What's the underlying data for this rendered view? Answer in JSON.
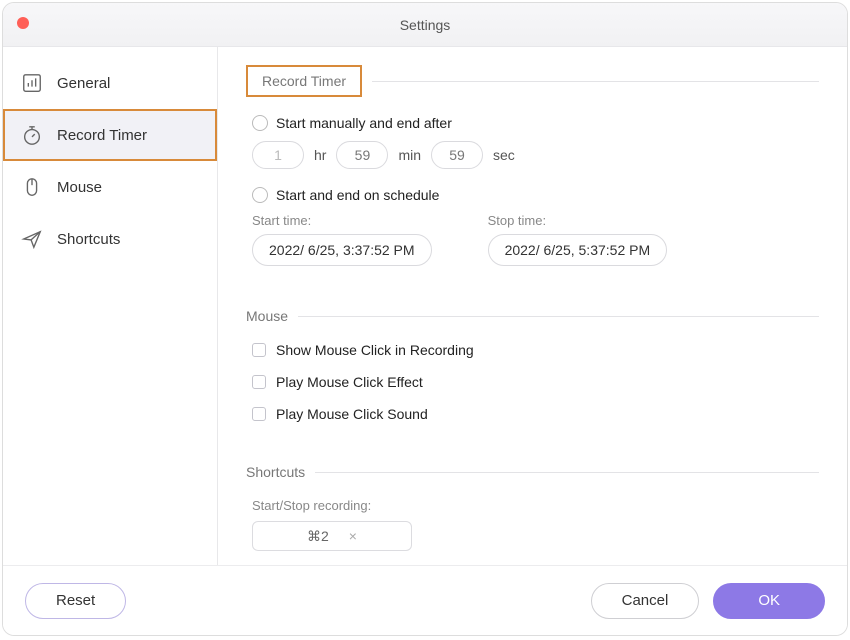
{
  "window": {
    "title": "Settings"
  },
  "sidebar": {
    "items": [
      {
        "label": "General"
      },
      {
        "label": "Record Timer"
      },
      {
        "label": "Mouse"
      },
      {
        "label": "Shortcuts"
      }
    ]
  },
  "sections": {
    "record_timer": {
      "title": "Record Timer",
      "radio_manual_label": "Start manually and end after",
      "hr_value": "1",
      "hr_unit": "hr",
      "min_value": "59",
      "min_unit": "min",
      "sec_value": "59",
      "sec_unit": "sec",
      "radio_schedule_label": "Start and end on schedule",
      "start_time_label": "Start time:",
      "start_time_value": "2022/  6/25,   3:37:52 PM",
      "stop_time_label": "Stop time:",
      "stop_time_value": "2022/  6/25,   5:37:52 PM"
    },
    "mouse": {
      "title": "Mouse",
      "check1": "Show Mouse Click in Recording",
      "check2": "Play Mouse Click Effect",
      "check3": "Play Mouse Click Sound"
    },
    "shortcuts": {
      "title": "Shortcuts",
      "label_startstop": "Start/Stop recording:",
      "startstop_value": "⌘2",
      "clear_glyph": "×"
    }
  },
  "footer": {
    "reset": "Reset",
    "cancel": "Cancel",
    "ok": "OK"
  }
}
